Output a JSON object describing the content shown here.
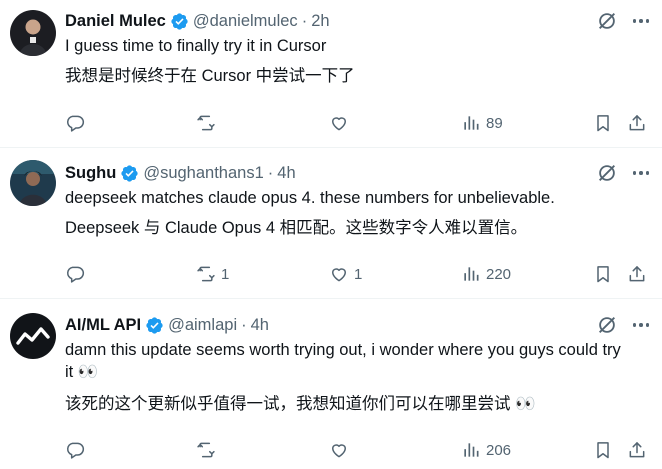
{
  "colors": {
    "verified": "#1d9bf0",
    "muted": "#536471",
    "text": "#0f1419",
    "divider": "#eff3f4"
  },
  "tweets": [
    {
      "name": "Daniel Mulec",
      "handle": "@danielmulec",
      "sep": "·",
      "time": "2h",
      "text1": "I guess time to finally try it in Cursor",
      "text2": "我想是时候终于在 Cursor 中尝试一下了",
      "replies": "",
      "retweets": "",
      "likes": "",
      "views": "89"
    },
    {
      "name": "Sughu",
      "handle": "@sughanthans1",
      "sep": "·",
      "time": "4h",
      "text1": "deepseek matches claude opus 4. these numbers for unbelievable.",
      "text2": "Deepseek 与 Claude Opus 4 相匹配。这些数字令人难以置信。",
      "replies": "",
      "retweets": "1",
      "likes": "1",
      "views": "220"
    },
    {
      "name": "AI/ML API",
      "handle": "@aimlapi",
      "sep": "·",
      "time": "4h",
      "text1": "damn this update seems worth trying out, i wonder where you guys could try it 👀",
      "text2": "该死的这个更新似乎值得一试，我想知道你们可以在哪里尝试 👀",
      "replies": "",
      "retweets": "",
      "likes": "",
      "views": "206"
    }
  ]
}
